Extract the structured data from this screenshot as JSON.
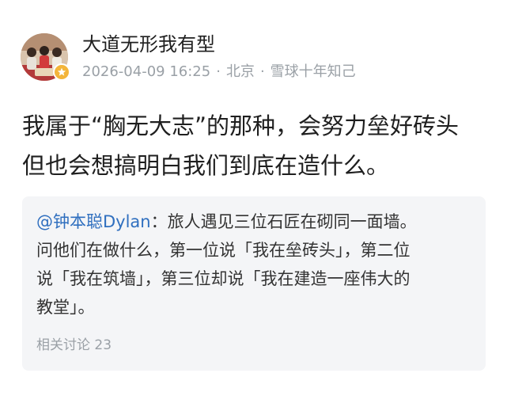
{
  "author": {
    "name": "大道无形我有型",
    "avatar_icon": "group-photo-avatar",
    "badge_icon": "verified-star-icon",
    "badge_color": "#f3b53a"
  },
  "meta": {
    "datetime": "2026-04-09 16:25",
    "separator": "·",
    "location": "北京",
    "source": "雪球十年知己"
  },
  "content": {
    "line1": "我属于“胸无大志”的那种，会努力垒好砖头",
    "line2": "但也会想搞明白我们到底在造什么。"
  },
  "quote": {
    "mention": "@钟本聪Dylan",
    "mention_color": "#2f6fbf",
    "line1_rest": "：旅人遇见三位石匠在砌同一面墙。",
    "line2": "问他们在做什么，第一位说「我在垒砖头」，第二位",
    "line3": "说「我在筑墙」，第三位却说「我在建造一座伟大的",
    "line4": "教堂」。",
    "related_label": "相关讨论 23"
  }
}
